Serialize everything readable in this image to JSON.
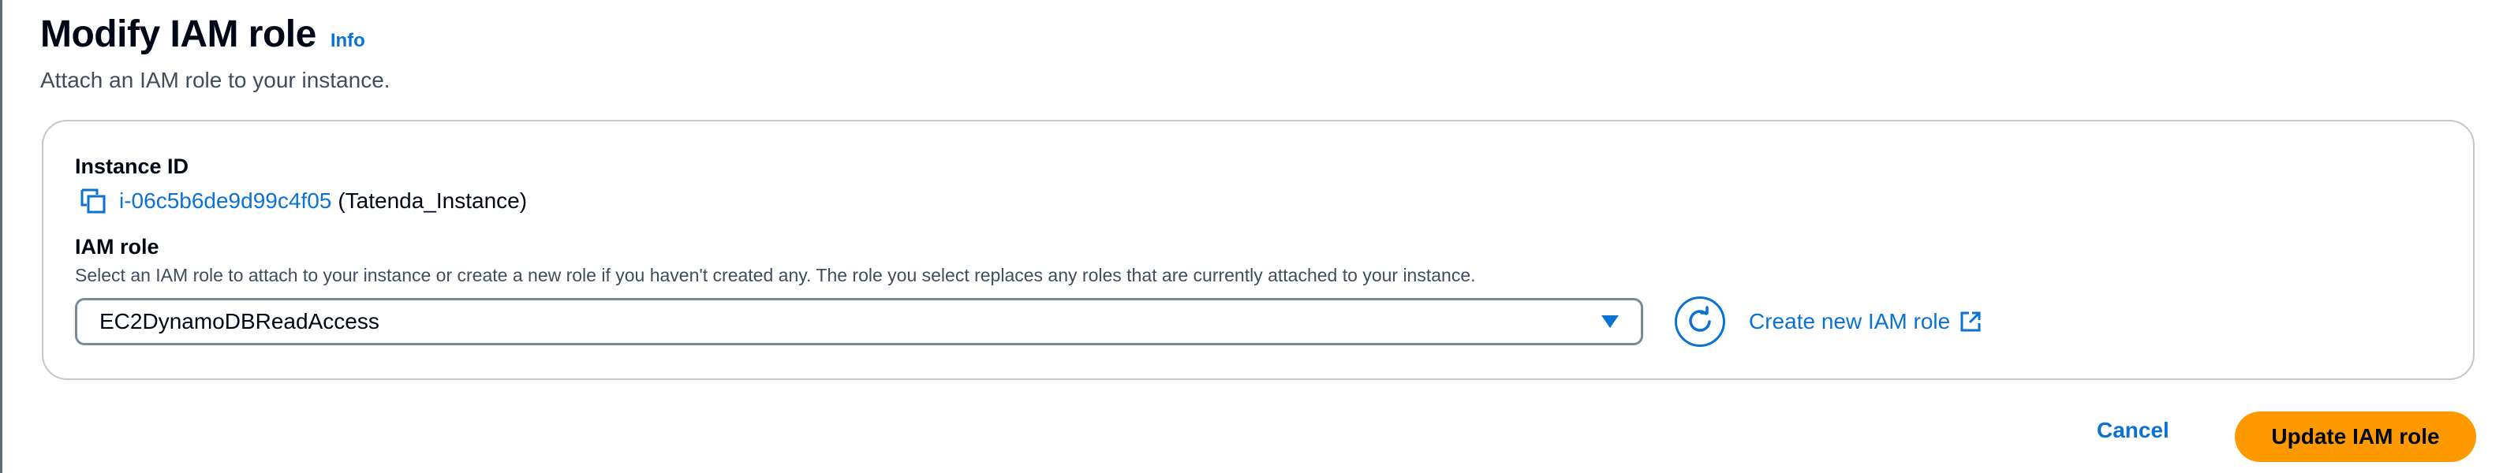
{
  "header": {
    "title": "Modify IAM role",
    "info_link": "Info",
    "subtitle": "Attach an IAM role to your instance."
  },
  "instance": {
    "label": "Instance ID",
    "id": "i-06c5b6de9d99c4f05",
    "name": "(Tatenda_Instance)"
  },
  "iam_role": {
    "label": "IAM role",
    "description": "Select an IAM role to attach to your instance or create a new role if you haven't created any. The role you select replaces any roles that are currently attached to your instance.",
    "selected_value": "EC2DynamoDBReadAccess",
    "create_link": "Create new IAM role"
  },
  "actions": {
    "cancel": "Cancel",
    "update": "Update IAM role"
  },
  "icons": {
    "copy": "copy-icon",
    "caret": "caret-down-icon",
    "refresh": "refresh-icon",
    "external": "external-link-icon"
  },
  "colors": {
    "link": "#0972d3",
    "primary_button": "#ff9900",
    "text": "#000716"
  }
}
